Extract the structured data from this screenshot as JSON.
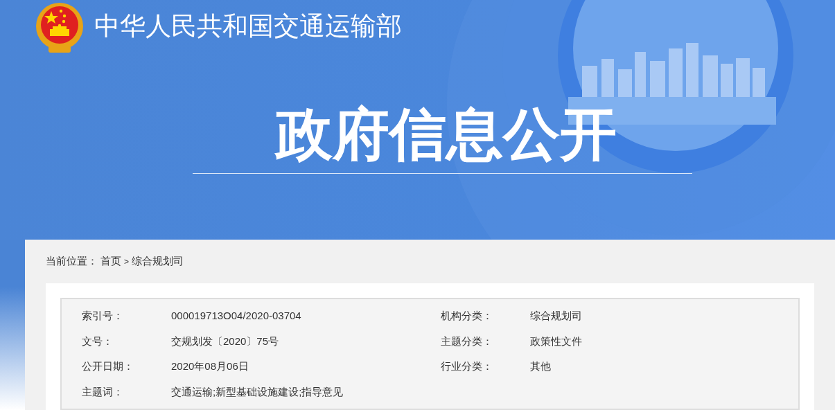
{
  "header": {
    "site_title": "中华人民共和国交通运输部",
    "page_title": "政府信息公开"
  },
  "breadcrumb": {
    "label": "当前位置：",
    "items": [
      {
        "text": "首页",
        "kind": "link"
      },
      {
        "text": ">",
        "kind": "separator"
      },
      {
        "text": "综合规划司",
        "kind": "link"
      }
    ]
  },
  "metadata": [
    {
      "label": "索引号：",
      "value": "000019713O04/2020-03704"
    },
    {
      "label": "机构分类：",
      "value": "综合规划司"
    },
    {
      "label": "文号：",
      "value": "交规划发〔2020〕75号"
    },
    {
      "label": "主题分类：",
      "value": "政策性文件"
    },
    {
      "label": "公开日期：",
      "value": "2020年08月06日"
    },
    {
      "label": "行业分类：",
      "value": "其他"
    },
    {
      "label": "主题词：",
      "value": "交通运输;新型基础设施建设;指导意见"
    }
  ]
}
